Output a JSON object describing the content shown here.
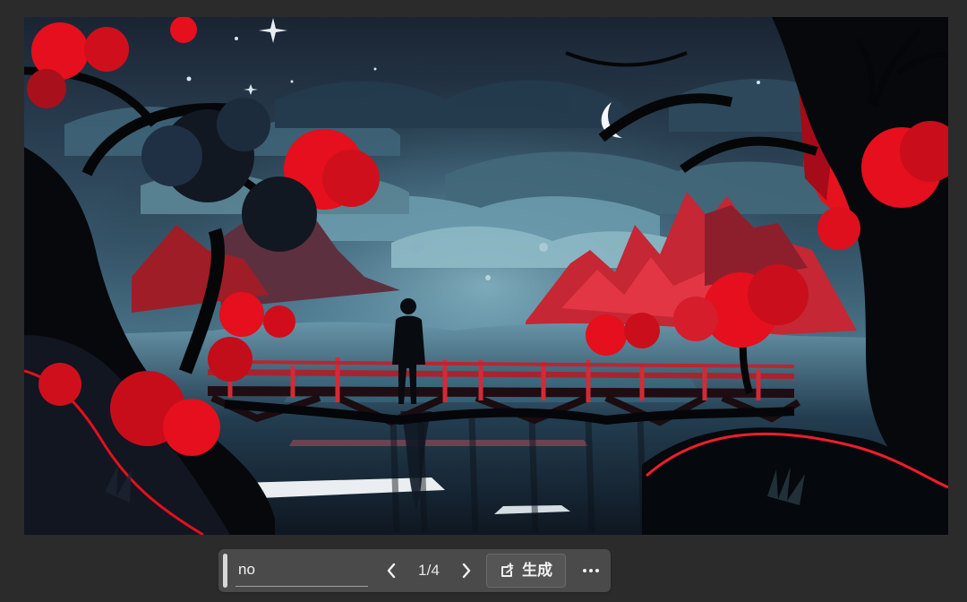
{
  "canvas": {
    "image": "generated-night-bridge-artwork"
  },
  "toolbar": {
    "prompt": {
      "value": "no",
      "placeholder": ""
    },
    "navigation": {
      "previous_icon": "chevron-left-icon",
      "next_icon": "chevron-right-icon",
      "current": 1,
      "total": 4,
      "label": "1/4"
    },
    "generate": {
      "label": "生成",
      "icon": "generate-icon"
    },
    "more_icon": "more-horizontal-icon"
  },
  "colors": {
    "app_background": "#2b2b2b",
    "toolbar_background": "#4a4a4a",
    "toolbar_button": "#555555",
    "text": "#f0f0f0",
    "accent_red": "#e50f1d"
  }
}
